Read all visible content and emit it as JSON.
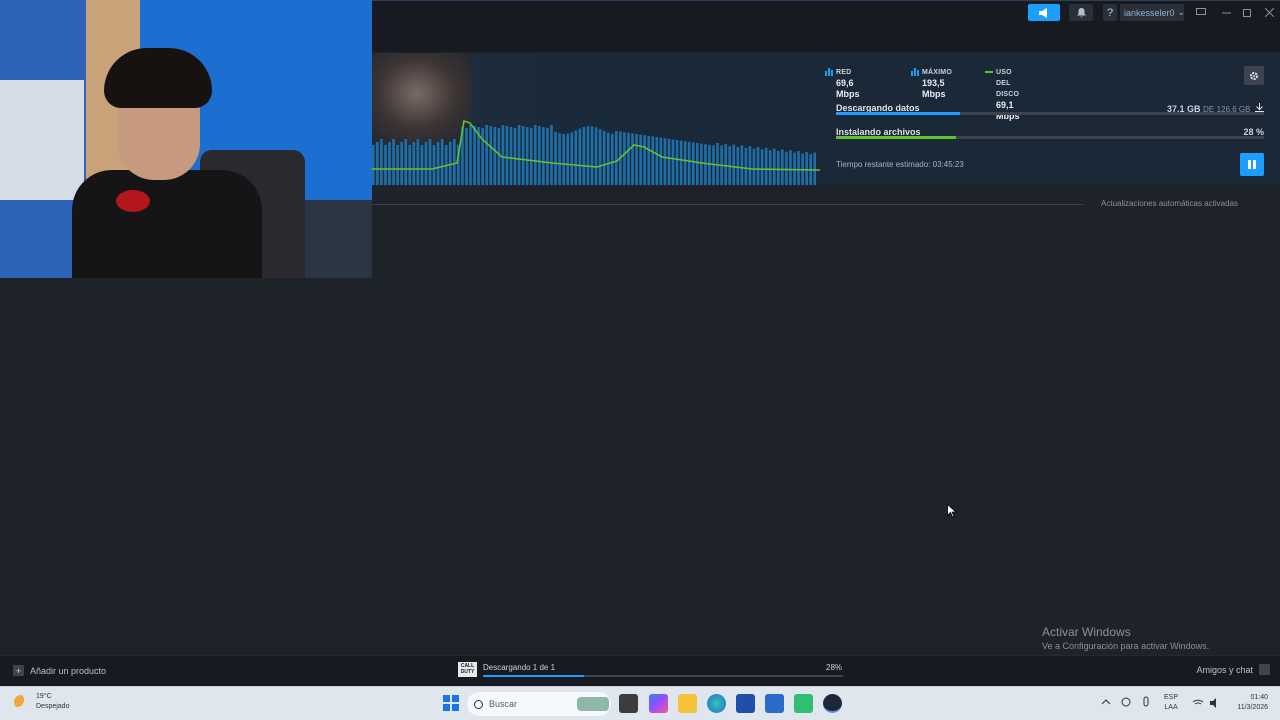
{
  "titlebar": {
    "help": "?",
    "username": "iankesseler0",
    "user_caret": "⌄"
  },
  "stats": {
    "network": {
      "label": "RED",
      "value": "69,6 Mbps"
    },
    "peak": {
      "label": "MÁXIMO",
      "value": "193,5 Mbps"
    },
    "disk": {
      "label": "USO DEL DISCO",
      "value": "69,1 Mbps"
    }
  },
  "downloading": {
    "label": "Descargando datos",
    "amount": "37,1 GB",
    "of": "DE",
    "total": "126,6 GB",
    "progress": 0.29
  },
  "installing": {
    "label": "Instalando archivos",
    "percent_text": "28 %",
    "progress": 0.28
  },
  "eta": "Tiempo restante estimado: 03:45:23",
  "auto_updates": "Actualizaciones automáticas activadas",
  "activate_windows": {
    "title": "Activar Windows",
    "subtitle": "Ve a Configuración para activar Windows."
  },
  "footer": {
    "add_product": "Añadir un producto",
    "game_logo": "CALL DUTY",
    "status": "Descargando 1 de 1",
    "percent": "28%",
    "progress": 0.28,
    "friends": "Amigos y chat"
  },
  "taskbar": {
    "weather_temp": "19°C",
    "weather_desc": "Despejado",
    "search_placeholder": "Buscar",
    "lang_1": "ESP",
    "lang_2": "LAA",
    "time": "01:40",
    "date": "11/3/2026"
  },
  "colors": {
    "steam_blue": "#1a9fff",
    "disk_green": "#5ec42e",
    "background": "#1e2229"
  }
}
